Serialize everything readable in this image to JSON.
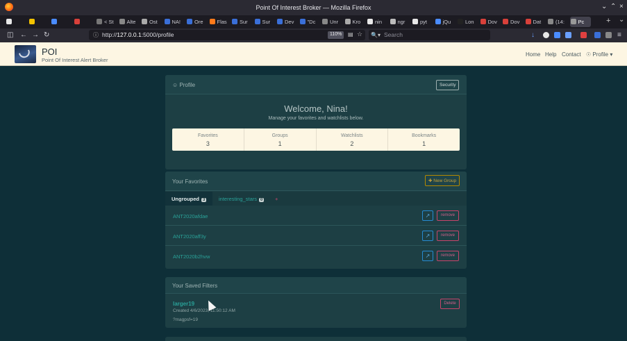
{
  "window": {
    "title": "Point Of Interest Broker — Mozilla Firefox"
  },
  "browser": {
    "tabs": [
      {
        "label": "",
        "color": "#e8e8e8"
      },
      {
        "label": "",
        "color": "#f2c200"
      },
      {
        "label": "",
        "color": "#4a8cff"
      },
      {
        "label": "",
        "color": "#d8403a"
      },
      {
        "label": "< St",
        "color": "#777"
      },
      {
        "label": "Alte",
        "color": "#888"
      },
      {
        "label": "Ost",
        "color": "#aaa"
      },
      {
        "label": "NA!",
        "color": "#3a6fd8"
      },
      {
        "label": "Ore",
        "color": "#3a6fd8"
      },
      {
        "label": "Flas",
        "color": "#ff7a1a"
      },
      {
        "label": "Sur",
        "color": "#3a6fd8"
      },
      {
        "label": "Sur",
        "color": "#3a6fd8"
      },
      {
        "label": "Dev",
        "color": "#3a6fd8"
      },
      {
        "label": "\"Dc",
        "color": "#3a6fd8"
      },
      {
        "label": "Unr",
        "color": "#888"
      },
      {
        "label": "Kro",
        "color": "#aaa"
      },
      {
        "label": "nin",
        "color": "#e8e8e8"
      },
      {
        "label": "ngr",
        "color": "#bbb"
      },
      {
        "label": "pyt",
        "color": "#e8e8e8"
      },
      {
        "label": "jQu",
        "color": "#4a8cff"
      },
      {
        "label": "Lon",
        "color": "#222"
      },
      {
        "label": "Dov",
        "color": "#d8403a"
      },
      {
        "label": "Dov",
        "color": "#d8403a"
      },
      {
        "label": "Dat",
        "color": "#d8403a"
      },
      {
        "label": "(14:",
        "color": "#888"
      },
      {
        "label": "Pc",
        "color": "#999",
        "active": true
      }
    ],
    "url_prefix": "http://",
    "url_host": "127.0.0.1",
    "url_rest": ":5000/profile",
    "zoom": "110%",
    "search_placeholder": "Search"
  },
  "app": {
    "title": "POI",
    "subtitle": "Point Of Interest Alert Broker",
    "nav": {
      "home": "Home",
      "help": "Help",
      "contact": "Contact",
      "profile": "Profile",
      "profile_icon": "user-circle-icon",
      "caret_icon": "caret-down-icon"
    }
  },
  "profile_panel": {
    "header": "Profile",
    "security_button": "Security",
    "welcome": "Welcome, Nina!",
    "manage_text": "Manage your favorites and watchlists below.",
    "stats": [
      {
        "label": "Favorites",
        "value": "3"
      },
      {
        "label": "Groups",
        "value": "1"
      },
      {
        "label": "Watchlists",
        "value": "2"
      },
      {
        "label": "Bookmarks",
        "value": "1"
      }
    ]
  },
  "favorites_panel": {
    "header": "Your Favorites",
    "new_group_button": "New Group",
    "tabs": [
      {
        "label": "Ungrouped",
        "count": "3"
      },
      {
        "label": "interesting_stars",
        "count": "0"
      }
    ],
    "add_tab": "+",
    "items": [
      {
        "name": "ANT2020afdae",
        "remove": "remove"
      },
      {
        "name": "ANT2020aff3y",
        "remove": "remove"
      },
      {
        "name": "ANT2020b2hvw",
        "remove": "remove"
      }
    ]
  },
  "filters_panel": {
    "header": "Your Saved Filters",
    "filter": {
      "name": "larger19",
      "created": "Created 4/6/2023, 11:50:12 AM",
      "query": "?magpsf=19",
      "delete": "Delete"
    }
  },
  "colors": {
    "page_bg": "#0e2f38",
    "panel_bg": "#1d3f44",
    "header_bg": "#fdf6e3",
    "link": "#2aa198",
    "accent_yellow": "#b58900",
    "danger": "#c7456b",
    "info": "#268bd2"
  }
}
